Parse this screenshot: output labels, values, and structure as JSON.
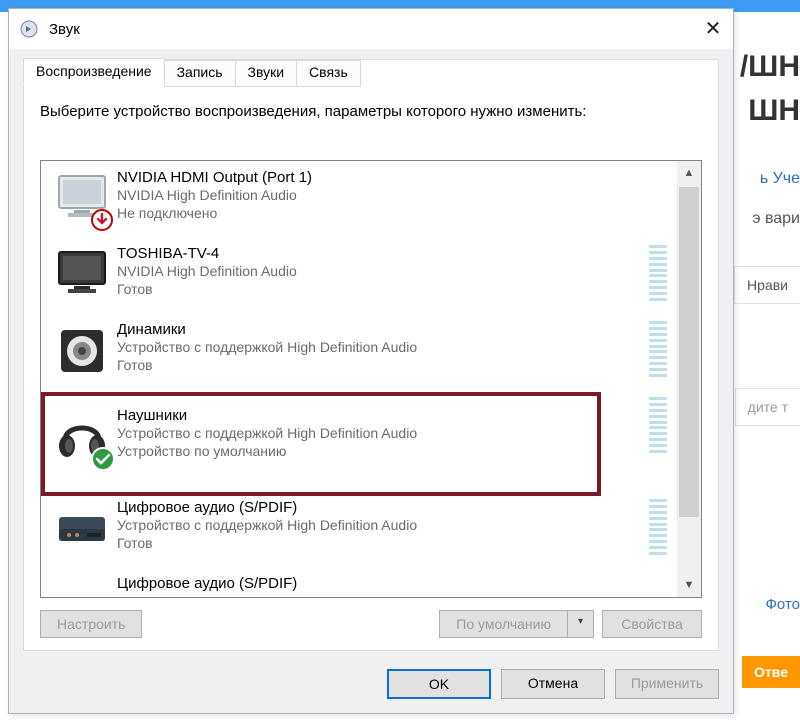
{
  "bg": {
    "h1a": "/ШН",
    "h1b": "ШН",
    "line1": "ь Уче",
    "line2": "э вари",
    "like": "Нрави",
    "placeholder": "дите т",
    "photo": "Фото",
    "answer": "Отве"
  },
  "dialog": {
    "title": "Звук",
    "tabs": [
      "Воспроизведение",
      "Запись",
      "Звуки",
      "Связь"
    ],
    "activeTab": 0,
    "instructions": "Выберите устройство воспроизведения, параметры которого нужно изменить:",
    "buttons": {
      "configure": "Настроить",
      "setDefault": "По умолчанию",
      "properties": "Свойства",
      "ok": "OK",
      "cancel": "Отмена",
      "apply": "Применить"
    },
    "devices": [
      {
        "name": "NVIDIA HDMI Output (Port 1)",
        "sub1": "NVIDIA High Definition Audio",
        "sub2": "Не подключено",
        "iconType": "monitor",
        "badge": "down",
        "meter": false
      },
      {
        "name": "TOSHIBA-TV-4",
        "sub1": "NVIDIA High Definition Audio",
        "sub2": "Готов",
        "iconType": "monitor",
        "badge": null,
        "meter": true
      },
      {
        "name": "Динамики",
        "sub1": "Устройство с поддержкой High Definition Audio",
        "sub2": "Готов",
        "iconType": "speaker",
        "badge": null,
        "meter": true
      },
      {
        "name": "Наушники",
        "sub1": "Устройство с поддержкой High Definition Audio",
        "sub2": "Устройство по умолчанию",
        "iconType": "headphones",
        "badge": "check",
        "meter": true
      },
      {
        "name": "Цифровое аудио (S/PDIF)",
        "sub1": "Устройство с поддержкой High Definition Audio",
        "sub2": "Готов",
        "iconType": "spdif",
        "badge": null,
        "meter": true
      },
      {
        "name": "Цифровое аудио (S/PDIF)",
        "sub1": "",
        "sub2": "",
        "iconType": "spdif",
        "badge": null,
        "meter": false
      }
    ]
  }
}
